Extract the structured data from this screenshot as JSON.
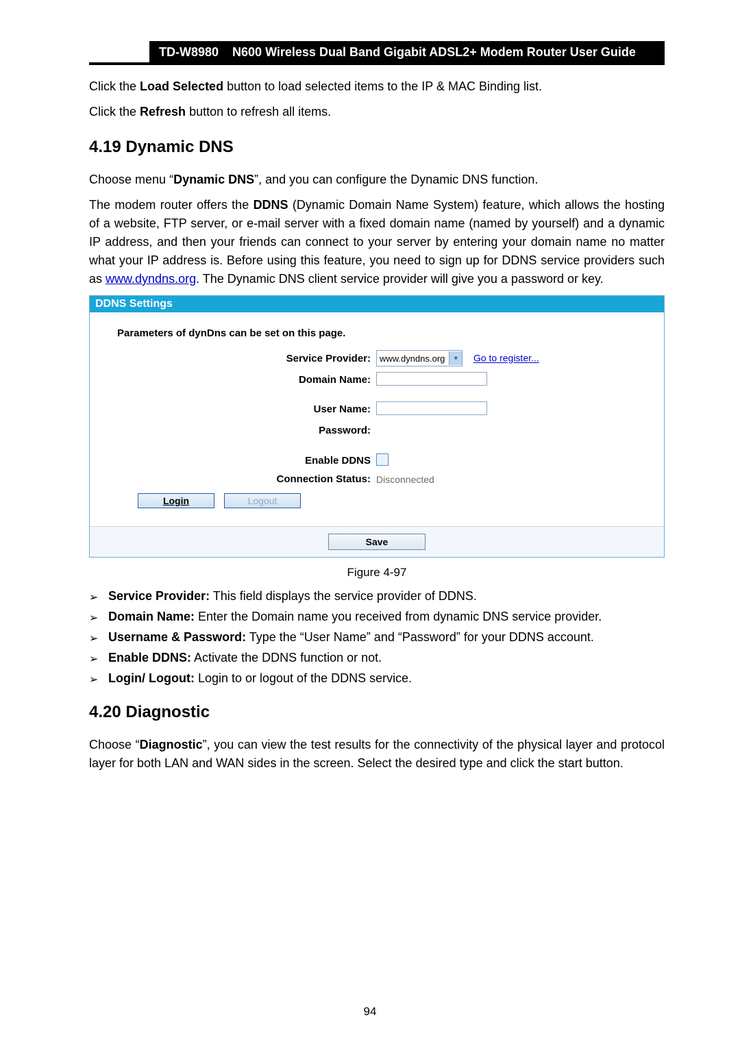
{
  "header": {
    "model": "TD-W8980",
    "title": "N600 Wireless Dual Band Gigabit ADSL2+ Modem Router User Guide"
  },
  "p_load": {
    "pre": "Click the ",
    "b": "Load Selected",
    "post": " button to load selected items to the IP & MAC Binding list."
  },
  "p_refresh": {
    "pre": "Click the ",
    "b": "Refresh",
    "post": " button to refresh all items."
  },
  "sec419": "4.19  Dynamic DNS",
  "p_choose": {
    "pre": "Choose menu “",
    "b": "Dynamic DNS",
    "post": "”, and you can configure the Dynamic DNS function."
  },
  "para419": {
    "t1": "The modem router offers the ",
    "b1": "DDNS",
    "t2": " (Dynamic Domain Name System) feature, which allows the hosting of a website, FTP server, or e-mail server with a fixed domain name (named by yourself) and a dynamic IP address, and then your friends can connect to your server by entering your domain name no matter what your IP address is. Before using this feature, you need to sign up for DDNS service providers such as ",
    "link": "www.dyndns.org",
    "t3": ". The Dynamic DNS client service provider will give you a password or key."
  },
  "ddns": {
    "panel_title": "DDNS Settings",
    "caption": "Parameters of dynDns can be set on this page.",
    "labels": {
      "sp": "Service Provider:",
      "dn": "Domain Name:",
      "un": "User Name:",
      "pw": "Password:",
      "en": "Enable DDNS",
      "cs": "Connection Status:"
    },
    "sp_value": "www.dyndns.org",
    "register_link": "Go to register...",
    "conn_status": "Disconnected",
    "login": "Login",
    "logout": "Logout",
    "save": "Save"
  },
  "figure_caption": "Figure 4-97",
  "bullets": [
    {
      "b": "Service Provider:",
      "t": " This field displays the service provider of DDNS."
    },
    {
      "b": "Domain Name:",
      "t": " Enter the Domain name you received from dynamic DNS service provider."
    },
    {
      "b": "Username & Password:",
      "t": " Type the “User Name” and “Password” for your DDNS account."
    },
    {
      "b": "Enable DDNS:",
      "t": " Activate the DDNS function or not."
    },
    {
      "b": "Login/ Logout:",
      "t": " Login to or logout of the DDNS service."
    }
  ],
  "sec420": "4.20  Diagnostic",
  "para420": {
    "pre": "Choose “",
    "b": "Diagnostic",
    "post": "”, you can view the test results for the connectivity of the physical layer and protocol layer for both LAN and WAN sides in the screen. Select the desired type and click the start button."
  },
  "page_number": "94"
}
